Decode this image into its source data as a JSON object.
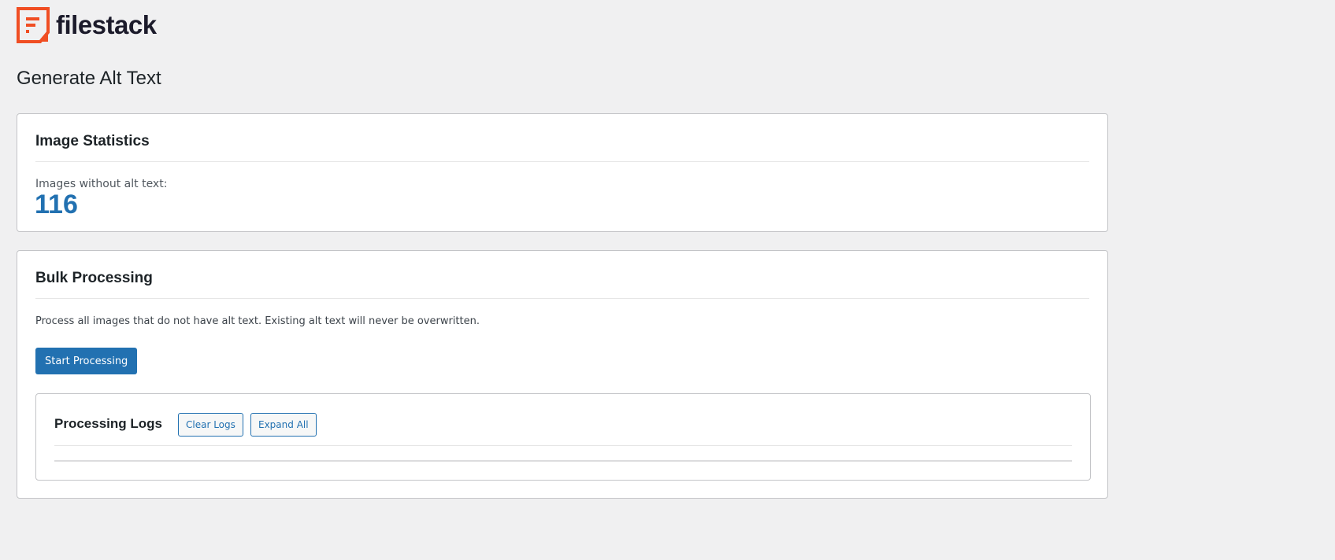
{
  "brand": {
    "name": "filestack",
    "color": "#f04e23"
  },
  "page_title": "Generate Alt Text",
  "stats": {
    "title": "Image Statistics",
    "label": "Images without alt text:",
    "count": "116"
  },
  "bulk": {
    "title": "Bulk Processing",
    "description": "Process all images that do not have alt text. Existing alt text will never be overwritten.",
    "start_label": "Start Processing"
  },
  "logs": {
    "title": "Processing Logs",
    "clear_label": "Clear Logs",
    "expand_label": "Expand All"
  }
}
